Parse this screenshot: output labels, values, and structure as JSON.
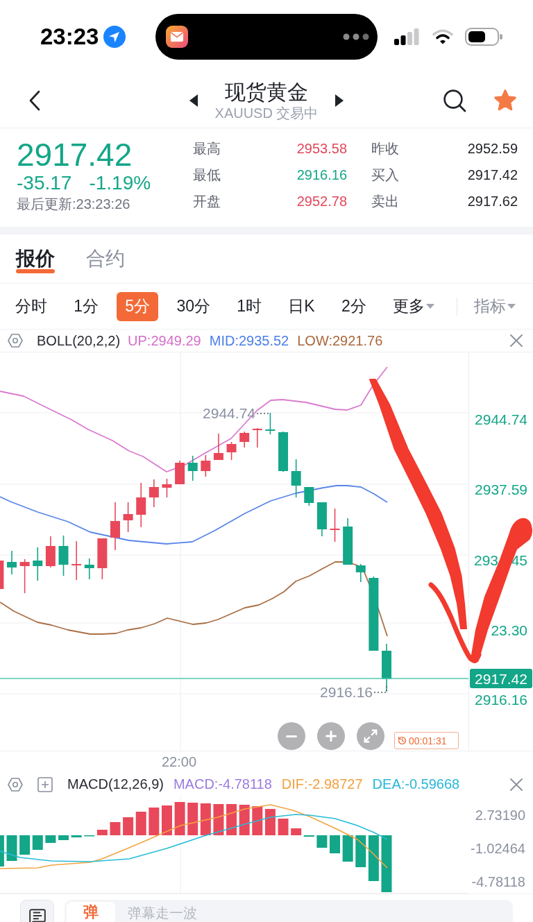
{
  "status_bar": {
    "time": "23:23"
  },
  "header": {
    "title": "现货黄金",
    "subtitle": "XAUUSD 交易中",
    "favorite": true
  },
  "quote": {
    "falling": true,
    "price": "2917.42",
    "change": "-35.17",
    "change_percent": "-1.19%",
    "updated": "最后更新:23:23:26",
    "stats": [
      {
        "label": "最高",
        "value": "2953.58",
        "color": "#e2485a"
      },
      {
        "label": "昨收",
        "value": "2952.59",
        "color": "#1f2128"
      },
      {
        "label": "最低",
        "value": "2916.16",
        "color": "#13a688"
      },
      {
        "label": "买入",
        "value": "2917.42",
        "color": "#1f2128"
      },
      {
        "label": "开盘",
        "value": "2952.78",
        "color": "#e2485a"
      },
      {
        "label": "卖出",
        "value": "2917.62",
        "color": "#1f2128"
      }
    ]
  },
  "tabs": [
    {
      "label": "报价",
      "selected": true
    },
    {
      "label": "合约",
      "selected": false
    }
  ],
  "intervals": [
    {
      "label": "分时",
      "selected": false,
      "dropdown": false
    },
    {
      "label": "1分",
      "selected": false,
      "dropdown": false
    },
    {
      "label": "5分",
      "selected": true,
      "dropdown": false
    },
    {
      "label": "30分",
      "selected": false,
      "dropdown": false
    },
    {
      "label": "1时",
      "selected": false,
      "dropdown": false
    },
    {
      "label": "日K",
      "selected": false,
      "dropdown": false
    },
    {
      "label": "2分",
      "selected": false,
      "dropdown": false
    },
    {
      "label": "更多",
      "selected": false,
      "dropdown": true
    }
  ],
  "indicator_button": {
    "label": "指标",
    "dropdown": true
  },
  "boll": {
    "name": "BOLL(20,2,2)",
    "up": "UP:2949.29",
    "mid": "MID:2935.52",
    "low": "LOW:2921.76"
  },
  "price_chart": {
    "axis_labels": [
      {
        "parts": [
          "2944.74"
        ]
      },
      {
        "parts": [
          "2937.59"
        ]
      },
      {
        "parts": [
          "293",
          "45"
        ]
      },
      {
        "parts": [
          "23.30"
        ]
      }
    ],
    "current_price": "2917.42",
    "low_axis_label": "2916.16",
    "high_marker": "2944.74",
    "low_marker": "2916.16",
    "time_label": "22:00",
    "countdown": "00:01:31"
  },
  "macd": {
    "name": "MACD(12,26,9)",
    "macd": "MACD:-4.78118",
    "dif": "DIF:-2.98727",
    "dea": "DEA:-0.59668",
    "axis_labels": [
      "2.73190",
      "-1.02464",
      "-4.78118"
    ]
  },
  "comment_bar": {
    "badge": "弹",
    "placeholder": "弹幕走一波"
  }
}
